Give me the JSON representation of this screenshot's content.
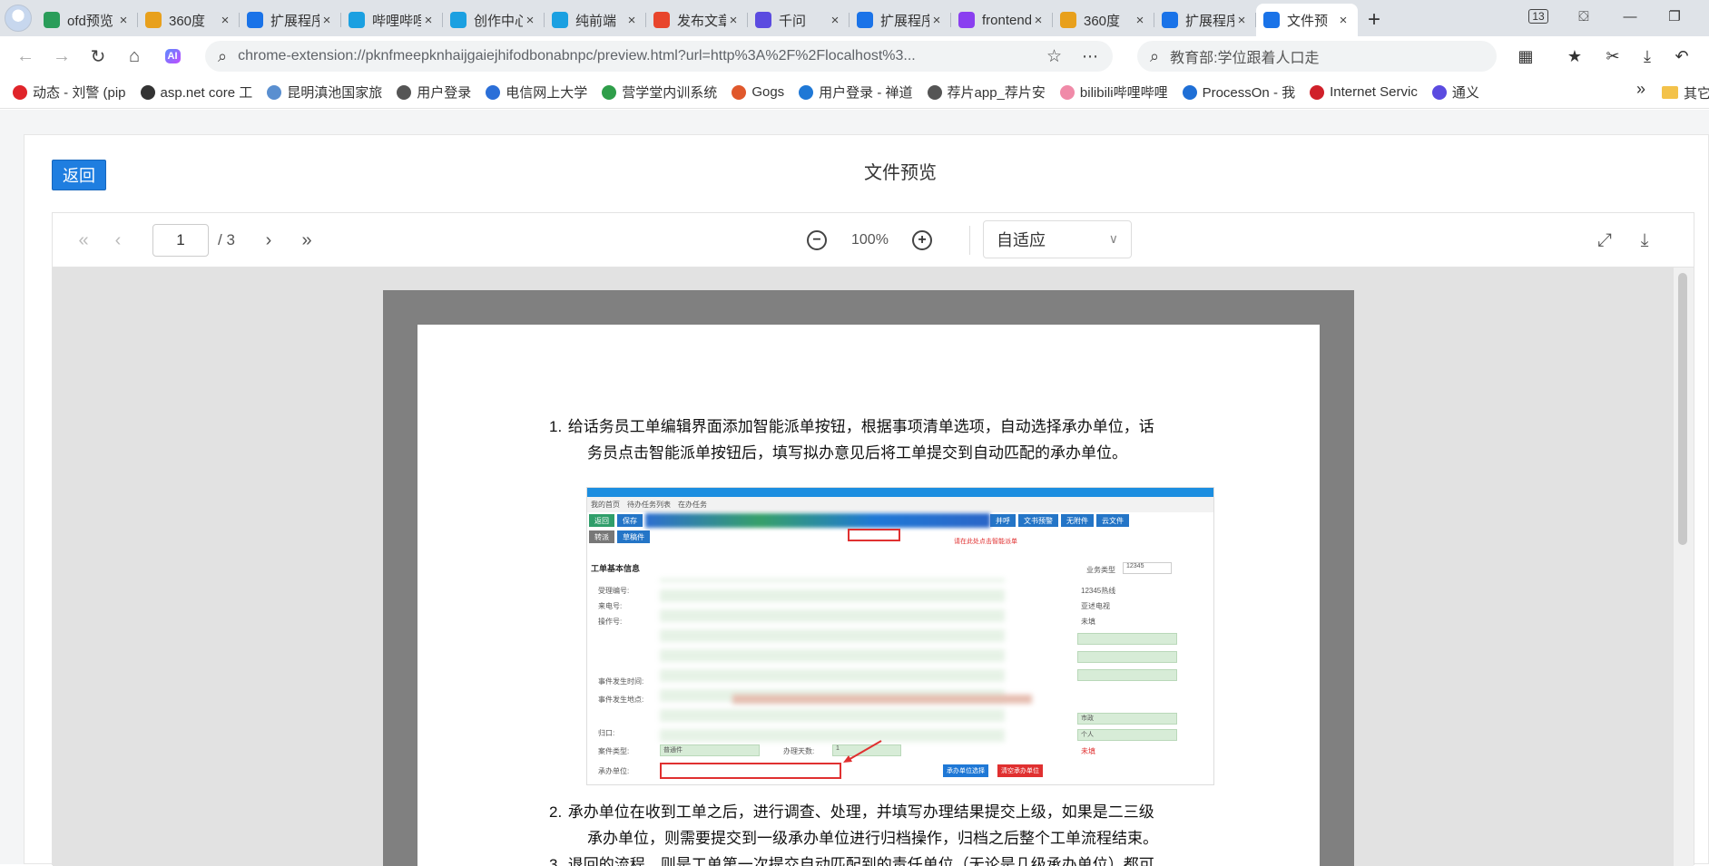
{
  "browser": {
    "tabs": [
      {
        "label": "ofd预览",
        "icon": "green-ring-icon",
        "color": "#2a9d5a"
      },
      {
        "label": "360度",
        "icon": "grid-icon",
        "color": "#e8a01c"
      },
      {
        "label": "扩展程序",
        "icon": "puzzle-icon",
        "color": "#1a73e8"
      },
      {
        "label": "哔哩哔哩",
        "icon": "bilibili-icon",
        "color": "#1ba0e1"
      },
      {
        "label": "创作中心",
        "icon": "bilibili-icon",
        "color": "#1ba0e1"
      },
      {
        "label": "纯前端",
        "icon": "bilibili-icon",
        "color": "#1ba0e1"
      },
      {
        "label": "发布文章",
        "icon": "csdn-icon",
        "color": "#e8452c"
      },
      {
        "label": "千问",
        "icon": "qianwen-icon",
        "color": "#5b4be0"
      },
      {
        "label": "扩展程序",
        "icon": "puzzle-icon",
        "color": "#1a73e8"
      },
      {
        "label": "frontend",
        "icon": "bolt-icon",
        "color": "#8a3ff0"
      },
      {
        "label": "360度",
        "icon": "grid-icon",
        "color": "#e8a01c"
      },
      {
        "label": "扩展程序",
        "icon": "puzzle-icon",
        "color": "#1a73e8"
      },
      {
        "label": "文件预",
        "icon": "file-icon",
        "color": "#1a73e8",
        "active": true
      }
    ],
    "tab_count": "13",
    "url": "chrome-extension://pknfmeepknhaijgaiejhifodbonabnpc/preview.html?url=http%3A%2F%2Flocalhost%3...",
    "search_text": "教育部:学位跟着人口走",
    "bookmarks": [
      {
        "label": "动态 - 刘警 (pip",
        "icon": "weibo-icon",
        "color": "#e0242a"
      },
      {
        "label": "asp.net core 工",
        "icon": "bird-icon",
        "color": "#333333"
      },
      {
        "label": "昆明滇池国家旅",
        "icon": "doc-icon",
        "color": "#5a8fd0"
      },
      {
        "label": "用户登录",
        "icon": "globe-icon",
        "color": "#555555"
      },
      {
        "label": "电信网上大学",
        "icon": "telecom-icon",
        "color": "#2b6fd8"
      },
      {
        "label": "营学堂内训系统",
        "icon": "leaf-icon",
        "color": "#2f9e4a"
      },
      {
        "label": "Gogs",
        "icon": "gogs-icon",
        "color": "#e0582c"
      },
      {
        "label": "用户登录 - 禅道",
        "icon": "zentao-icon",
        "color": "#1f78d6"
      },
      {
        "label": "荐片app_荐片安",
        "icon": "globe-icon",
        "color": "#555555"
      },
      {
        "label": "bilibili哔哩哔哩",
        "icon": "bilibili-icon",
        "color": "#f08aa8"
      },
      {
        "label": "ProcessOn - 我",
        "icon": "processon-icon",
        "color": "#1f6fd6"
      },
      {
        "label": "Internet Servic",
        "icon": "h3c-icon",
        "color": "#d0202a"
      },
      {
        "label": "通义",
        "icon": "tongyi-icon",
        "color": "#5b4be0"
      }
    ],
    "other_bookmarks": "其它收藏"
  },
  "page": {
    "back_label": "返回",
    "title": "文件预览",
    "viewer": {
      "current_page": "1",
      "total_pages": "/ 3",
      "zoom": "100%",
      "fit_mode": "自适应"
    },
    "document": {
      "items": [
        {
          "num": "1.",
          "line1": "给话务员工单编辑界面添加智能派单按钮，根据事项清单选项，自动选择承办单位，话",
          "line2": "务员点击智能派单按钮后，填写拟办意见后将工单提交到自动匹配的承办单位。"
        },
        {
          "num": "2.",
          "line1": "承办单位在收到工单之后，进行调查、处理，并填写办理结果提交上级，如果是二三级",
          "line2": "承办单位，则需要提交到一级承办单位进行归档操作，归档之后整个工单流程结束。"
        },
        {
          "num": "3.",
          "line1": "退回的流程，则是工单第一次提交自动匹配到的责任单位（无论是几级承办单位）都可",
          "line2": ""
        }
      ],
      "screenshot": {
        "tabs": [
          "我的首页",
          "待办任务列表",
          "在办任务"
        ],
        "buttons": [
          "返回",
          "保存",
          "并呼",
          "文书预警",
          "无附件",
          "云文件"
        ],
        "sub_buttons": [
          "转派",
          "草稿件"
        ],
        "section_title": "工单基本信息",
        "biz_type_label": "业务类型",
        "biz_type_value": "12345",
        "row_labels": [
          "受理编号:",
          "来电号:",
          "操作号:",
          "事件发生时间:",
          "事件发生地点:",
          "归口:",
          "案件类型:",
          "承办单位:"
        ],
        "right_values": [
          "12345热线",
          "亚述电视",
          "未填",
          "市政",
          "个人",
          "未填"
        ],
        "case_type_value": "普通件",
        "days_label": "办理天数:",
        "days_value": "1",
        "select_unit_btn": "承办单位选择",
        "clear_unit_btn": "清空承办单位",
        "red_note": "请在此处点击智能派单"
      }
    }
  }
}
